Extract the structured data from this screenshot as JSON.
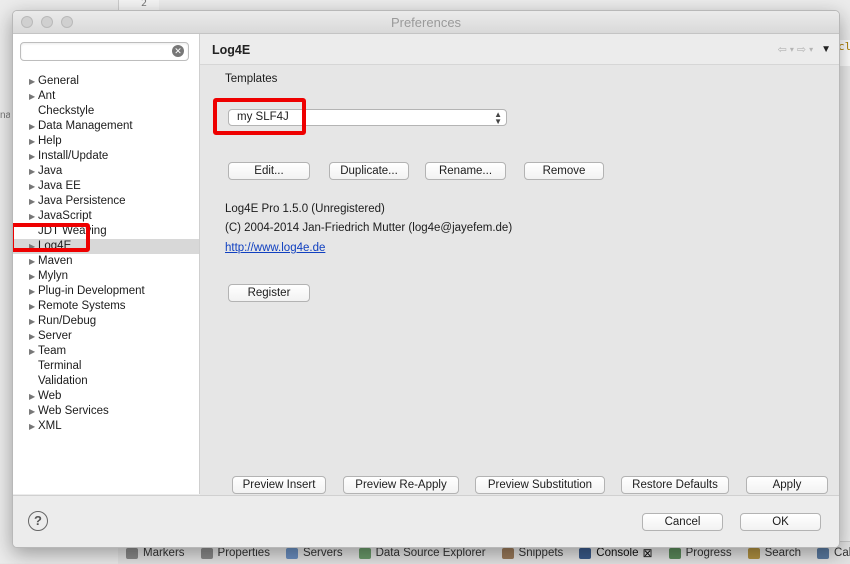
{
  "window": {
    "title": "Preferences"
  },
  "background": {
    "line_number": "2",
    "editor_fragment": "cl",
    "left_fragment": "na",
    "bottom_tabs": [
      {
        "label": "Markers",
        "icon": "markers-icon",
        "color": "#8a8a8a"
      },
      {
        "label": "Properties",
        "icon": "properties-icon",
        "color": "#8a8a8a"
      },
      {
        "label": "Servers",
        "icon": "servers-icon",
        "color": "#6a8fc0"
      },
      {
        "label": "Data Source Explorer",
        "icon": "data-source-icon",
        "color": "#6a9a6a"
      },
      {
        "label": "Snippets",
        "icon": "snippets-icon",
        "color": "#9a7a5a"
      },
      {
        "label": "Console",
        "icon": "console-icon",
        "color": "#3a5a8a"
      },
      {
        "label": "Progress",
        "icon": "progress-icon",
        "color": "#5a8a5a"
      },
      {
        "label": "Search",
        "icon": "search-icon",
        "color": "#b09040"
      },
      {
        "label": "Call H",
        "icon": "call-hierarchy-icon",
        "color": "#5a7aa0"
      }
    ],
    "console_close": "⊠"
  },
  "search": {
    "placeholder": "",
    "value": "",
    "clear_glyph": "✕"
  },
  "tree": [
    {
      "label": "General",
      "expandable": true
    },
    {
      "label": "Ant",
      "expandable": true
    },
    {
      "label": "Checkstyle",
      "expandable": false
    },
    {
      "label": "Data Management",
      "expandable": true
    },
    {
      "label": "Help",
      "expandable": true
    },
    {
      "label": "Install/Update",
      "expandable": true
    },
    {
      "label": "Java",
      "expandable": true
    },
    {
      "label": "Java EE",
      "expandable": true
    },
    {
      "label": "Java Persistence",
      "expandable": true
    },
    {
      "label": "JavaScript",
      "expandable": true
    },
    {
      "label": "JDT Weaving",
      "expandable": false
    },
    {
      "label": "Log4E",
      "expandable": true,
      "selected": true
    },
    {
      "label": "Maven",
      "expandable": true
    },
    {
      "label": "Mylyn",
      "expandable": true
    },
    {
      "label": "Plug-in Development",
      "expandable": true
    },
    {
      "label": "Remote Systems",
      "expandable": true
    },
    {
      "label": "Run/Debug",
      "expandable": true
    },
    {
      "label": "Server",
      "expandable": true
    },
    {
      "label": "Team",
      "expandable": true
    },
    {
      "label": "Terminal",
      "expandable": false
    },
    {
      "label": "Validation",
      "expandable": false
    },
    {
      "label": "Web",
      "expandable": true
    },
    {
      "label": "Web Services",
      "expandable": true
    },
    {
      "label": "XML",
      "expandable": true
    }
  ],
  "page": {
    "title": "Log4E",
    "nav_back": "⇦",
    "nav_forward": "⇨",
    "nav_menu": "▼",
    "templates_label": "Templates",
    "template_selected": "my SLF4J",
    "template_buttons": [
      "Edit...",
      "Duplicate...",
      "Rename...",
      "Remove"
    ],
    "product_line": "Log4E Pro 1.5.0 (Unregistered)",
    "copyright_line": "(C) 2004-2014 Jan-Friedrich Mutter (log4e@jayefem.de)",
    "website": "http://www.log4e.de",
    "register_label": "Register",
    "bottom_buttons": [
      "Preview Insert",
      "Preview Re-Apply",
      "Preview Substitution",
      "Restore Defaults",
      "Apply"
    ]
  },
  "footer": {
    "help_glyph": "?",
    "cancel_label": "Cancel",
    "ok_label": "OK"
  },
  "colors": {
    "annotation": "#ee0000",
    "link": "#1040c0",
    "selection": "#d8d8d8"
  }
}
